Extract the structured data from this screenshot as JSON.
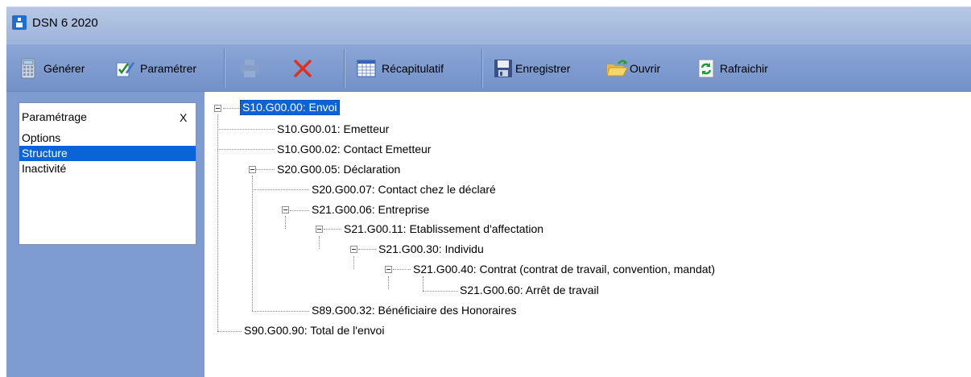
{
  "window": {
    "title": "DSN 6 2020"
  },
  "toolbar": {
    "generer": "Générer",
    "parametrer": "Paramétrer",
    "recapitulatif": "Récapitulatif",
    "enregistrer": "Enregistrer",
    "ouvrir": "Ouvrir",
    "rafraichir": "Rafraichir"
  },
  "panel": {
    "title": "Paramétrage",
    "close": "X",
    "items": [
      "Options",
      "Structure",
      "Inactivité"
    ],
    "selected": "Structure"
  },
  "tree": {
    "nodes": [
      "S10.G00.00: Envoi",
      "S10.G00.01: Emetteur",
      "S10.G00.02: Contact Emetteur",
      "S20.G00.05: Déclaration",
      "S20.G00.07: Contact chez le déclaré",
      "S21.G00.06: Entreprise",
      "S21.G00.11: Etablissement d'affectation",
      "S21.G00.30: Individu",
      "S21.G00.40: Contrat (contrat de travail, convention, mandat)",
      "S21.G00.60: Arrêt de travail",
      "S89.G00.32: Bénéficiaire des Honoraires",
      "S90.G00.90: Total de l'envoi"
    ],
    "selected": "S10.G00.00: Envoi"
  },
  "colors": {
    "selection": "#0a64d8",
    "toolbar": "#7f9cd0",
    "delete": "#e03020"
  }
}
